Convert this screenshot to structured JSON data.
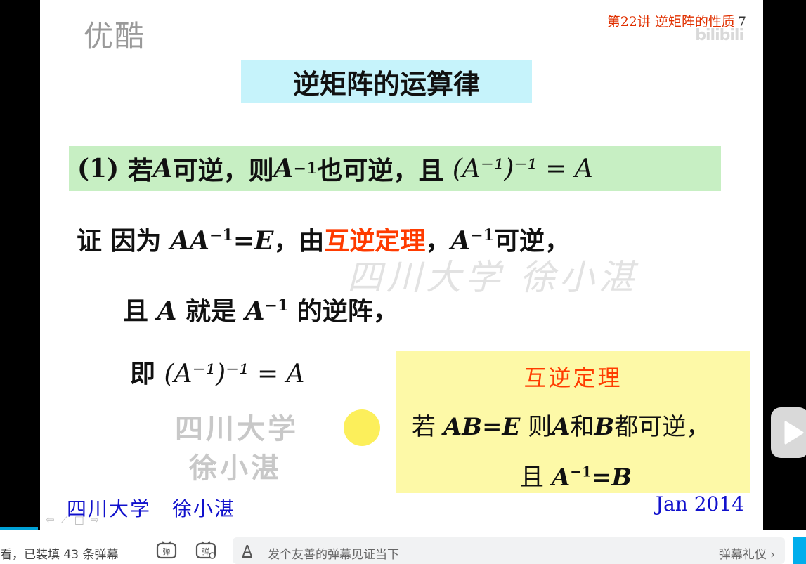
{
  "watermark": {
    "brand": "优酷",
    "bili": "bilibili",
    "center": "四川大学 徐小湛",
    "bottom_line1": "四川大学",
    "bottom_line2": "徐小湛"
  },
  "slide": {
    "lecture": "第22讲 逆矩阵的性质",
    "page_num": "7",
    "title": "逆矩阵的运算律",
    "prop1": {
      "label": "(1)",
      "t1": "若",
      "A": "A",
      "t2": "可逆，则",
      "Ainv": "A",
      "sup": "−1",
      "t3": "也可逆，且",
      "formula": "(A⁻¹)⁻¹ = A"
    },
    "proof": {
      "l1_pre": "证  因为 ",
      "l1_math": "AA",
      "l1_sup": "−1",
      "l1_eq": "=E",
      "l1_mid": "，由",
      "l1_red": "互逆定理",
      "l1_comma": "，",
      "l1_A": "A",
      "l1_sup2": "−1",
      "l1_end": "可逆，",
      "l2_a": "且 ",
      "l2_A": "A",
      "l2_b": " 就是 ",
      "l2_A2": "A",
      "l2_sup": "−1",
      "l2_c": " 的逆阵，",
      "l3_a": "即  ",
      "l3_formula": "(A⁻¹)⁻¹ = A"
    },
    "theorem": {
      "heading": "互逆定理",
      "l1_a": "若 ",
      "l1_AB": "AB",
      "l1_eq": "=E",
      "l1_b": " 则",
      "l1_A": "A",
      "l1_c": "和",
      "l1_B": "B",
      "l1_d": "都可逆，",
      "l2_a": "且 ",
      "l2_A": "A",
      "l2_sup": "−1",
      "l2_eq": "=",
      "l2_B": "B"
    },
    "author": "四川大学　徐小湛",
    "date": "Jan 2014",
    "nav": "⇦ ⟋ □ ⇨"
  },
  "bottombar": {
    "status": "看，已装填 43 条弹幕",
    "placeholder": "发个友善的弹幕见证当下",
    "gift": "弹幕礼仪 ›"
  }
}
